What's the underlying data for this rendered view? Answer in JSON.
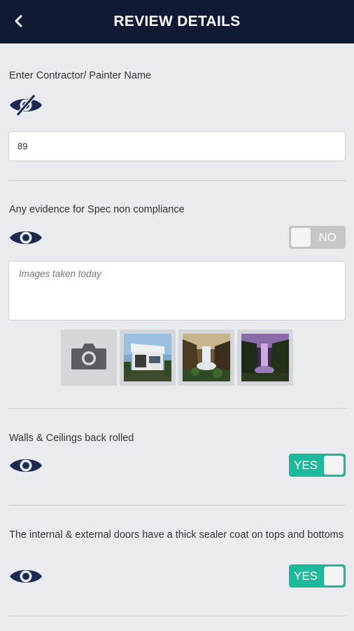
{
  "header": {
    "title": "REVIEW DETAILS",
    "back_icon": "chevron-left-icon"
  },
  "contractor": {
    "label": "Enter Contractor/ Painter Name",
    "visibility_icon": "eye-slash-icon",
    "value": "89"
  },
  "evidence": {
    "label": "Any evidence for Spec non compliance",
    "visibility_icon": "eye-icon",
    "toggle_label": "NO",
    "toggle_state": false,
    "notes_placeholder": "Images taken today",
    "camera_icon": "camera-icon",
    "photos": [
      "house-photo",
      "waterfall-photo",
      "purple-waterfall-photo"
    ]
  },
  "walls": {
    "label": "Walls & Ceilings back rolled",
    "visibility_icon": "eye-icon",
    "toggle_label": "YES",
    "toggle_state": true
  },
  "doors": {
    "label": "The internal & external doors have a thick sealer coat on tops and bottoms",
    "visibility_icon": "eye-icon",
    "toggle_label": "YES",
    "toggle_state": true
  },
  "colors": {
    "header_bg": "#0f1a35",
    "accent_on": "#1eb89c",
    "toggle_off": "#c4c6c9",
    "eye_icon": "#1a2a52"
  }
}
